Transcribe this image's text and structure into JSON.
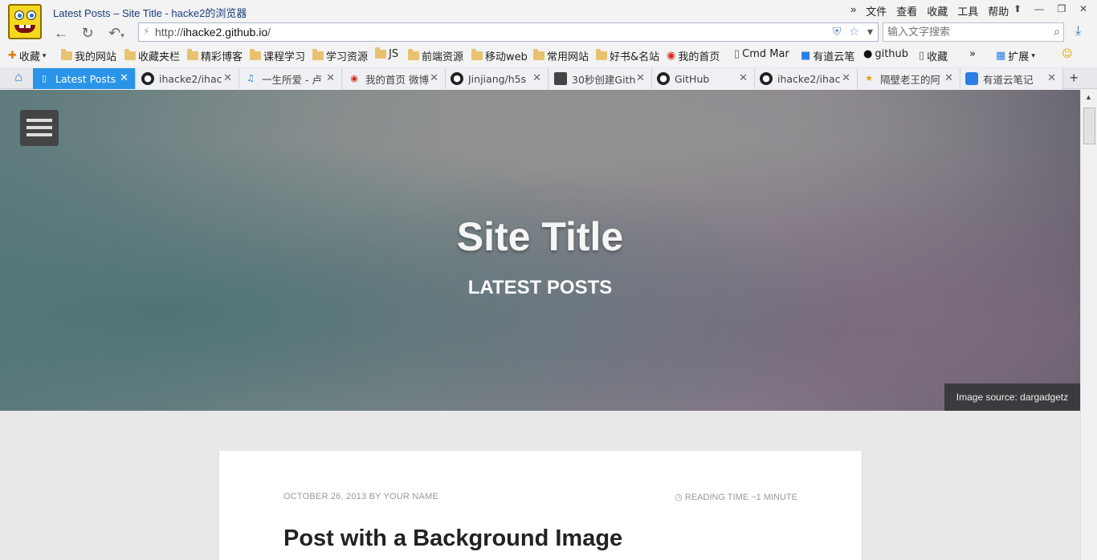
{
  "window": {
    "title": "Latest Posts – Site Title - hacke2的浏览器",
    "menu": [
      "文件",
      "查看",
      "收藏",
      "工具",
      "帮助"
    ]
  },
  "address_bar": {
    "url_prefix": "http://",
    "url_host": "ihacke2.github.io",
    "url_suffix": "/"
  },
  "search": {
    "placeholder": "输入文字搜索"
  },
  "bookmarks": [
    {
      "label": "收藏",
      "icon": "add-favorite-icon"
    },
    {
      "label": "我的网站",
      "icon": "folder-icon"
    },
    {
      "label": "收藏夹栏",
      "icon": "folder-icon"
    },
    {
      "label": "精彩博客",
      "icon": "folder-icon"
    },
    {
      "label": "课程学习",
      "icon": "folder-icon"
    },
    {
      "label": "学习资源",
      "icon": "folder-icon"
    },
    {
      "label": "JS",
      "icon": "folder-icon"
    },
    {
      "label": "前端资源",
      "icon": "folder-icon"
    },
    {
      "label": "移动web",
      "icon": "folder-icon"
    },
    {
      "label": "常用网站",
      "icon": "folder-icon"
    },
    {
      "label": "好书&名站",
      "icon": "folder-icon"
    },
    {
      "label": "我的首页",
      "icon": "weibo-icon"
    },
    {
      "label": "Cmd Mar",
      "icon": "page-icon"
    },
    {
      "label": "有道云笔",
      "icon": "youdao-icon"
    },
    {
      "label": "github",
      "icon": "github-icon"
    },
    {
      "label": "收藏",
      "icon": "page-icon"
    }
  ],
  "bookmarks_extra": {
    "expand_label": "扩展"
  },
  "tabs": [
    {
      "label": "Latest Posts",
      "icon": "page-icon",
      "active": true
    },
    {
      "label": "ihacke2/ihac",
      "icon": "github-icon"
    },
    {
      "label": "一生所爱 - 卢",
      "icon": "headphones-icon"
    },
    {
      "label": "我的首页 微博",
      "icon": "weibo-icon"
    },
    {
      "label": "Jinjiang/h5s",
      "icon": "github-icon"
    },
    {
      "label": "30秒创建Gith",
      "icon": "image-icon"
    },
    {
      "label": "GitHub",
      "icon": "github-icon"
    },
    {
      "label": "ihacke2/ihac",
      "icon": "github-icon"
    },
    {
      "label": "隔壁老王的阿",
      "icon": "star-icon"
    },
    {
      "label": "有道云笔记",
      "icon": "youdao-icon"
    }
  ],
  "page": {
    "site_title": "Site Title",
    "subtitle": "LATEST POSTS",
    "image_source": "Image source: dargadgetz",
    "post": {
      "meta": "OCTOBER 26, 2013 BY YOUR NAME",
      "reading_time": "READING TIME ~1 MINUTE",
      "title": "Post with a Background Image"
    }
  },
  "colors": {
    "active_tab": "#2a95e8",
    "page_background": "#e8e8e8",
    "card_background": "#ffffff"
  }
}
